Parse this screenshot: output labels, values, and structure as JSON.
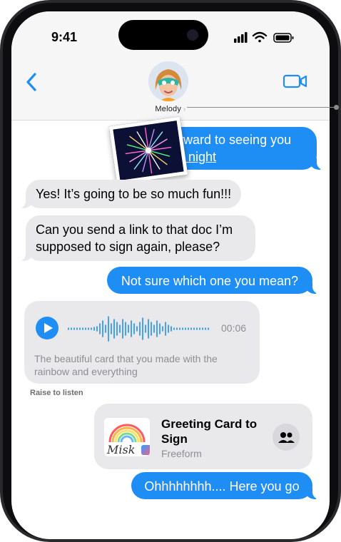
{
  "status_bar": {
    "time": "9:41"
  },
  "header": {
    "contact_name": "Melody"
  },
  "messages": [
    {
      "id": "m1",
      "direction": "out",
      "text_before": "forward to seeing you",
      "link_text": "ow night"
    },
    {
      "id": "m2",
      "direction": "in",
      "text": "Yes! It’s going to be so much fun!!!"
    },
    {
      "id": "m3",
      "direction": "in",
      "text": "Can you send a link to that doc I’m supposed to sign again, please?"
    },
    {
      "id": "m4",
      "direction": "out",
      "text": "Not sure which one you mean?"
    }
  ],
  "audio_message": {
    "duration": "00:06",
    "transcript": "The beautiful card that you made with the rainbow and everything",
    "hint": "Raise to listen"
  },
  "freeform_card": {
    "title": "Greeting Card to Sign",
    "subtitle": "Freeform",
    "thumb_text": "Misk"
  },
  "last_message": {
    "direction": "out",
    "text": "Ohhhhhhhh.... Here you go"
  },
  "colors": {
    "accent": "#1f8ef4",
    "incoming": "#e9e9eb",
    "muted": "#8e8e93"
  },
  "icons": [
    "back-chevron-icon",
    "video-camera-icon",
    "signal-icon",
    "wifi-icon",
    "battery-icon",
    "play-icon",
    "collaborate-icon",
    "freeform-app-icon"
  ]
}
